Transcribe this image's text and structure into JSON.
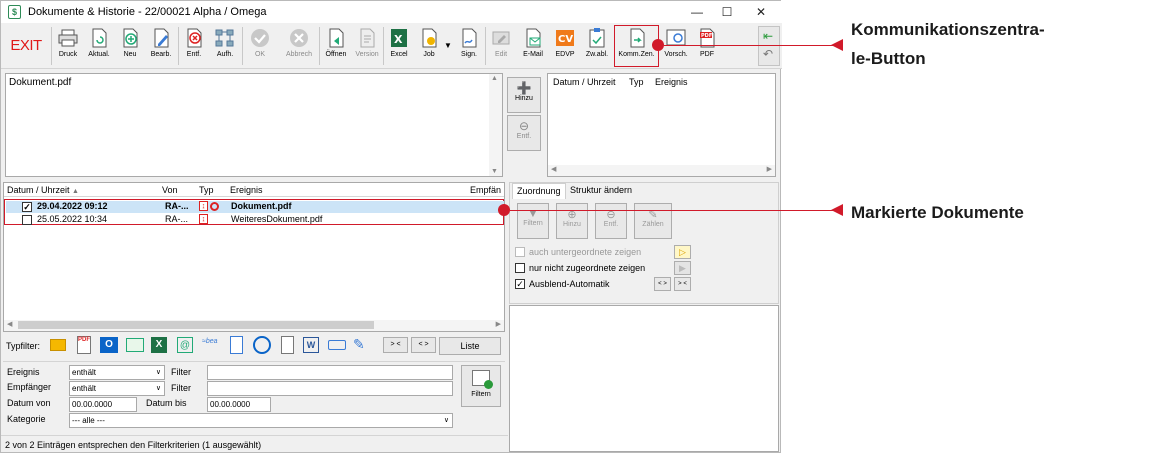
{
  "window": {
    "title": "Dokumente & Historie - 22/00021 Alpha / Omega",
    "app_icon": "dollar-doc-icon"
  },
  "toolbar": {
    "exit_label": "EXIT",
    "buttons": [
      {
        "label": "Druck",
        "icon": "printer-icon"
      },
      {
        "label": "Aktual.",
        "icon": "refresh-doc-icon"
      },
      {
        "label": "Neu",
        "icon": "new-doc-icon"
      },
      {
        "label": "Bearb.",
        "icon": "edit-doc-icon"
      },
      {
        "label": "Entf.",
        "icon": "delete-doc-icon"
      },
      {
        "label": "Aufh.",
        "icon": "hierarchy-icon"
      },
      {
        "label": "OK",
        "icon": "check-circle-icon"
      },
      {
        "label": "Abbrech",
        "icon": "cancel-circle-icon"
      },
      {
        "label": "Öffnen",
        "icon": "open-doc-icon"
      },
      {
        "label": "Version",
        "icon": "version-icon"
      },
      {
        "label": "Excel",
        "icon": "excel-icon"
      },
      {
        "label": "Job",
        "icon": "job-icon"
      },
      {
        "label": "Sign.",
        "icon": "sign-icon"
      },
      {
        "label": "Edit",
        "icon": "edit-icon"
      },
      {
        "label": "E-Mail",
        "icon": "email-icon"
      },
      {
        "label": "EDVP",
        "icon": "cv-icon"
      },
      {
        "label": "Zw.abl.",
        "icon": "clipboard-icon"
      },
      {
        "label": "Komm.Zen.",
        "icon": "communication-icon"
      },
      {
        "label": "Vorsch.",
        "icon": "preview-icon"
      },
      {
        "label": "PDF",
        "icon": "pdf-icon"
      }
    ]
  },
  "preview": {
    "filename": "Dokument.pdf"
  },
  "side_buttons": {
    "hinzu": "Hinzu",
    "entf": "Entf."
  },
  "history_table": {
    "col_datetime": "Datum / Uhrzeit",
    "col_type": "Typ",
    "col_event": "Ereignis"
  },
  "doc_table": {
    "columns": {
      "datetime": "Datum / Uhrzeit",
      "from": "Von",
      "type": "Typ",
      "event": "Ereignis",
      "recipient": "Empfän"
    },
    "rows": [
      {
        "datetime": "29.04.2022  09:12",
        "from": "RA-...",
        "event": "Dokument.pdf",
        "checked": "✓"
      },
      {
        "datetime": "25.05.2022  10:34",
        "from": "RA-...",
        "event": "WeiteresDokument.pdf",
        "checked": ""
      }
    ]
  },
  "right_tabs": {
    "tab1": "Zuordnung",
    "tab2": "Struktur ändern"
  },
  "assign_buttons": [
    "Filtern",
    "Hinzu",
    "Entf.",
    "Zählen"
  ],
  "options": {
    "show_sub": "auch untergeordnete zeigen",
    "show_unassigned": "nur nicht zugeordnete zeigen",
    "auto_hide": "Ausblend-Automatik",
    "auto_hide_check": "✓"
  },
  "typfilter": {
    "label": "Typfilter:",
    "btn_a": "> <",
    "btn_b": "< >",
    "list": "Liste"
  },
  "filter": {
    "event_label": "Ereignis",
    "recipient_label": "Empfänger",
    "date_from_label": "Datum von",
    "date_to_label": "Datum bis",
    "category_label": "Kategorie",
    "op1": "enthält",
    "op2": "enthält",
    "filter_word": "Filter",
    "date_from": "00.00.0000",
    "date_to": "00.00.0000",
    "category": "--- alle ---",
    "filter_button": "Filtern"
  },
  "status": "2 von 2 Einträgen entsprechen den Filterkriterien (1 ausgewählt)",
  "annotations": {
    "comm_line1": "Kommunikationszentra-",
    "comm_line2": "le-Button",
    "marked": "Markierte Dokumente"
  },
  "colors": {
    "accent_red": "#d11a2a",
    "selection": "#cce4f7"
  }
}
